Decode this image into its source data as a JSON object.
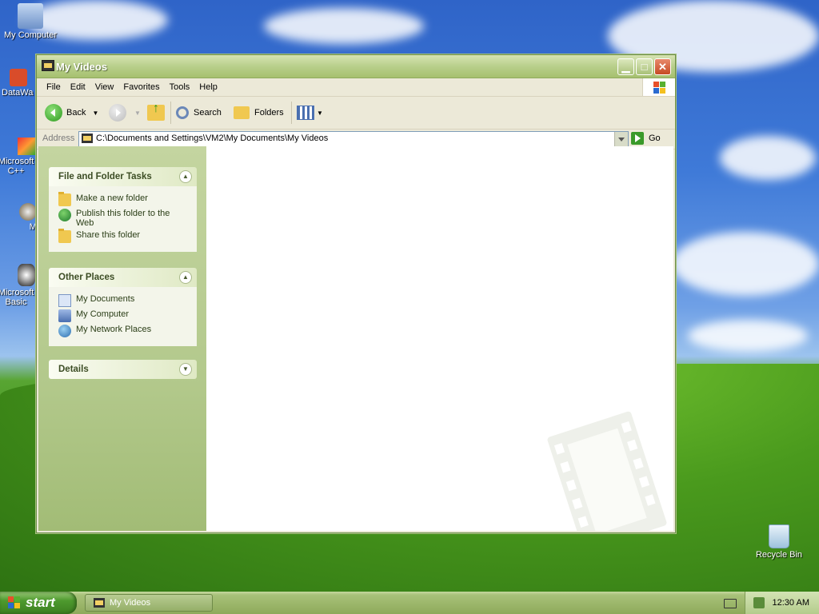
{
  "desktop": {
    "icons": [
      {
        "label": "My Computer",
        "icon": "my-computer-icon"
      },
      {
        "label": "DataWa",
        "icon": "shortcut-icon"
      },
      {
        "label": "Microsoft C++",
        "icon": "shortcut-icon"
      },
      {
        "label": "Myp",
        "icon": "shortcut-icon"
      },
      {
        "label": "Microsoft Basic",
        "icon": "shortcut-icon"
      },
      {
        "label": "Recycle Bin",
        "icon": "recycle-bin-icon"
      }
    ]
  },
  "window": {
    "title": "My Videos",
    "menu": [
      "File",
      "Edit",
      "View",
      "Favorites",
      "Tools",
      "Help"
    ],
    "toolbar": {
      "back_label": "Back",
      "search_label": "Search",
      "folders_label": "Folders"
    },
    "address": {
      "label": "Address",
      "value": "C:\\Documents and Settings\\VM2\\My Documents\\My Videos",
      "go_label": "Go"
    },
    "sidebar": {
      "panels": [
        {
          "title": "File and Folder Tasks",
          "items": [
            "Make a new folder",
            "Publish this folder to the Web",
            "Share this folder"
          ]
        },
        {
          "title": "Other Places",
          "items": [
            "My Documents",
            "My Computer",
            "My Network Places"
          ]
        },
        {
          "title": "Details",
          "items": []
        }
      ]
    }
  },
  "taskbar": {
    "start_label": "start",
    "task_label": "My Videos",
    "clock": "12:30 AM"
  },
  "colors": {
    "titlebar": "#a6c06f",
    "taskbar": "#9db86c",
    "start": "#4e9a2e"
  }
}
